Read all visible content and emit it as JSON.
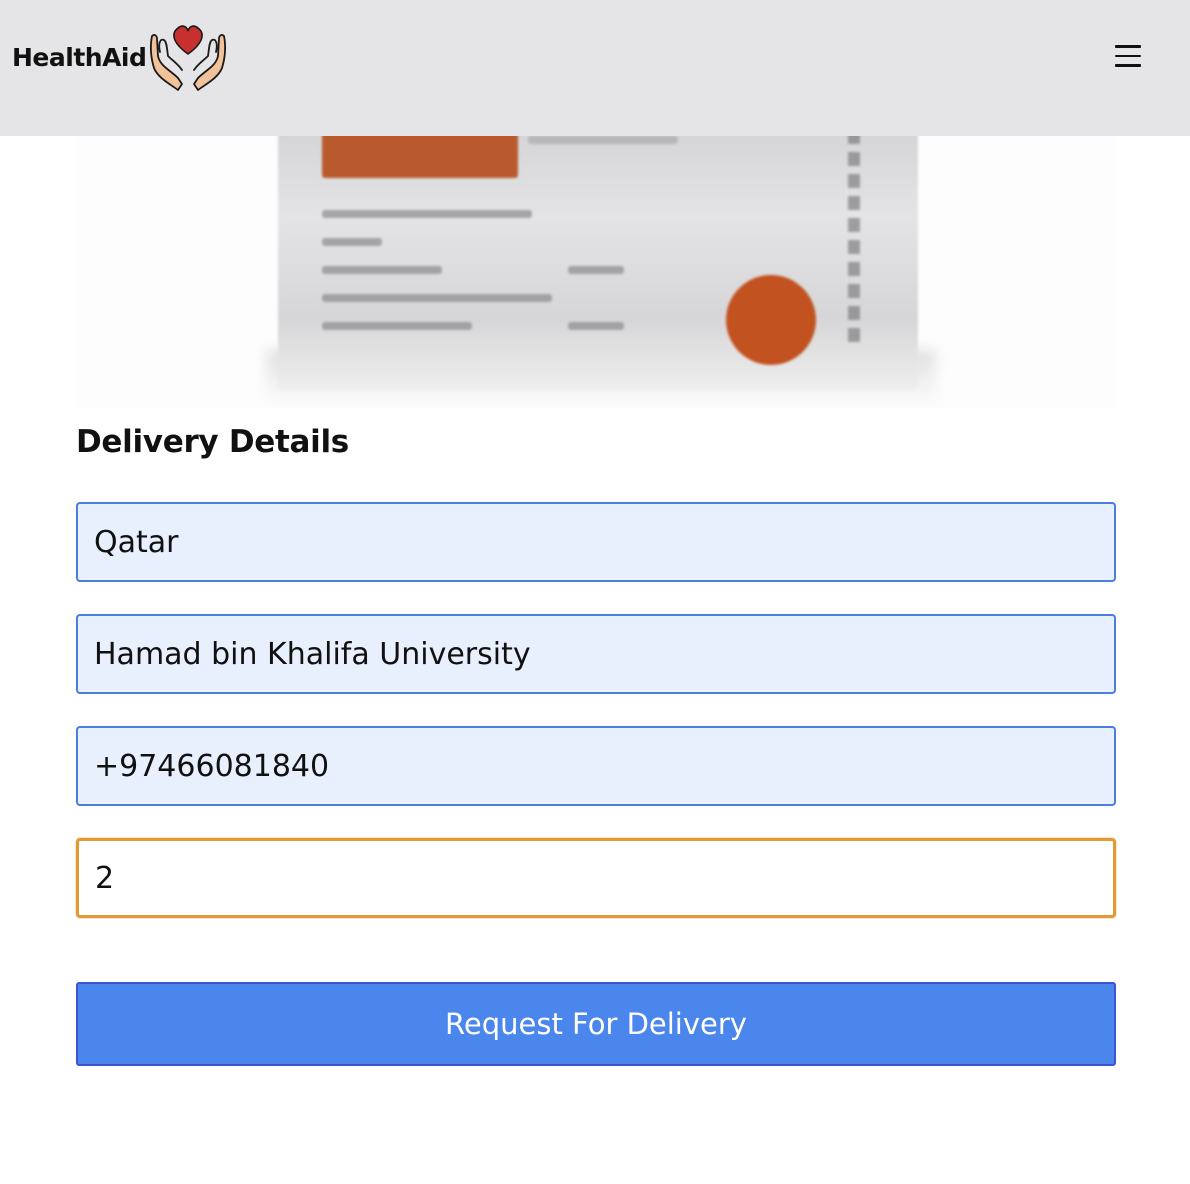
{
  "header": {
    "brand_name": "HealthAid",
    "logo_icon": "heart-in-hands-icon",
    "menu_icon": "hamburger-menu-icon"
  },
  "product": {
    "image_icon": "medicine-pack-image"
  },
  "delivery": {
    "title": "Delivery Details",
    "country_value": "Qatar",
    "address_value": "Hamad bin Khalifa University",
    "phone_value": "+97466081840",
    "quantity_value": "2",
    "submit_label": "Request For Delivery"
  },
  "colors": {
    "header_bg": "#e5e5e7",
    "field_bg": "#e8f0fd",
    "field_border": "#4a7de0",
    "focus_border": "#e39a35",
    "button_bg": "#4a86ec",
    "heart": "#c8302f"
  }
}
